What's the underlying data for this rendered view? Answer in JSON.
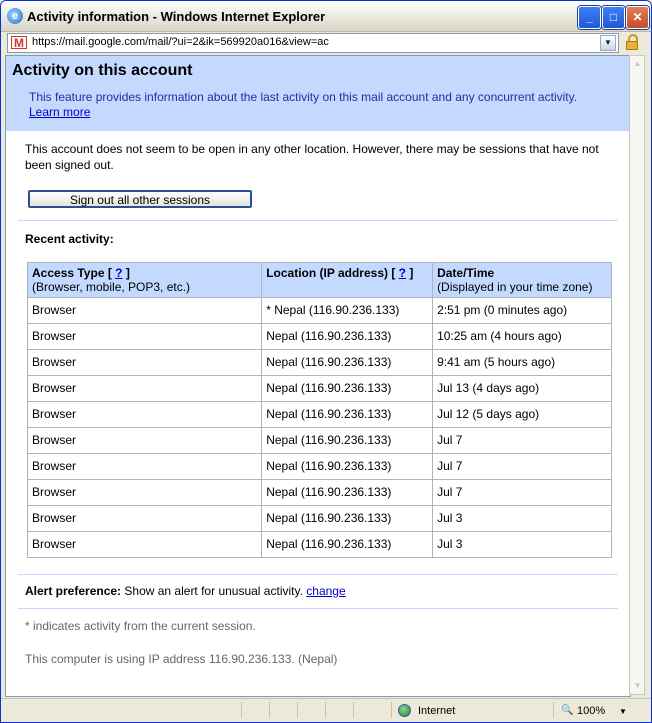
{
  "window": {
    "title": "Activity information - Windows Internet Explorer",
    "minimize": "_",
    "maximize": "□",
    "close": "✕"
  },
  "address_bar": {
    "url": "https://mail.google.com/mail/?ui=2&ik=569920a016&view=ac",
    "favicon_letter": "M"
  },
  "header": {
    "title": "Activity on this account",
    "description": "This feature provides information about the last activity on this mail account and any concurrent activity.",
    "learn_more": "Learn more"
  },
  "status_message": "This account does not seem to be open in any other location. However, there may be sessions that have not been signed out.",
  "sign_out_button": "Sign out all other sessions",
  "recent_activity_label": "Recent activity:",
  "table": {
    "headers": [
      {
        "title": "Access Type",
        "help": "?",
        "sub": "(Browser, mobile, POP3, etc.)"
      },
      {
        "title": "Location (IP address)",
        "help": "?",
        "sub": ""
      },
      {
        "title": "Date/Time",
        "help": "",
        "sub": "(Displayed in your time zone)"
      }
    ],
    "rows": [
      [
        "Browser",
        "* Nepal (116.90.236.133)",
        "2:51 pm (0 minutes ago)"
      ],
      [
        "Browser",
        "Nepal (116.90.236.133)",
        "10:25 am (4 hours ago)"
      ],
      [
        "Browser",
        "Nepal (116.90.236.133)",
        "9:41 am (5 hours ago)"
      ],
      [
        "Browser",
        "Nepal (116.90.236.133)",
        "Jul 13 (4 days ago)"
      ],
      [
        "Browser",
        "Nepal (116.90.236.133)",
        "Jul 12 (5 days ago)"
      ],
      [
        "Browser",
        "Nepal (116.90.236.133)",
        "Jul 7"
      ],
      [
        "Browser",
        "Nepal (116.90.236.133)",
        "Jul 7"
      ],
      [
        "Browser",
        "Nepal (116.90.236.133)",
        "Jul 7"
      ],
      [
        "Browser",
        "Nepal (116.90.236.133)",
        "Jul 3"
      ],
      [
        "Browser",
        "Nepal (116.90.236.133)",
        "Jul 3"
      ]
    ]
  },
  "alert": {
    "label": "Alert preference:",
    "text": "Show an alert for unusual activity.",
    "change": "change"
  },
  "footnote": "* indicates activity from the current session.",
  "ip_note": "This computer is using IP address 116.90.236.133. (Nepal)",
  "statusbar": {
    "zone": "Internet",
    "zoom": "100%"
  },
  "icons": {
    "browser": "ie-icon",
    "favicon": "gmail-icon",
    "security": "lock-icon",
    "zone": "globe-icon",
    "zoom": "magnifier-icon"
  }
}
